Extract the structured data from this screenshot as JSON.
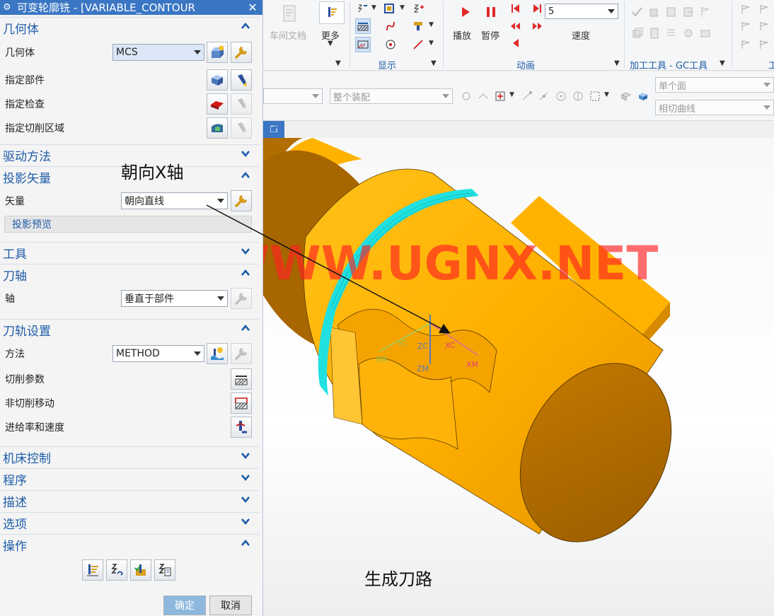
{
  "dialog": {
    "title": "可变轮廓铣 - [VARIABLE_CONTOUR",
    "geometry": {
      "header": "几何体",
      "geometry_label": "几何体",
      "geometry_value": "MCS",
      "part_label": "指定部件",
      "check_label": "指定检查",
      "cut_area_label": "指定切削区域"
    },
    "drive_method": {
      "header": "驱动方法"
    },
    "projection_vector": {
      "header": "投影矢量",
      "vector_label": "矢量",
      "vector_value": "朝向直线",
      "preview_label": "投影预览"
    },
    "tool": {
      "header": "工具"
    },
    "tool_axis": {
      "header": "刀轴",
      "axis_label": "轴",
      "axis_value": "垂直于部件"
    },
    "path_settings": {
      "header": "刀轨设置",
      "method_label": "方法",
      "method_value": "METHOD",
      "cut_params_label": "切削参数",
      "non_cutting_label": "非切削移动",
      "feeds_label": "进给率和速度"
    },
    "machine_control": {
      "header": "机床控制"
    },
    "program": {
      "header": "程序"
    },
    "description": {
      "header": "描述"
    },
    "options": {
      "header": "选项"
    },
    "actions": {
      "header": "操作"
    },
    "ok_label": "确定",
    "cancel_label": "取消"
  },
  "ribbon": {
    "shop_doc_label": "车间文档",
    "more_label": "更多",
    "display_group": "显示",
    "play_label": "播放",
    "pause_label": "暂停",
    "speed_value": "5",
    "speed_label": "速度",
    "animation_group": "动画",
    "gc_tools_group": "加工工具 - GC工具",
    "edge_group_char": "工"
  },
  "toolbar": {
    "assembly_value": "整个装配",
    "face_filter": "单个面",
    "curve_filter": "相切曲线"
  },
  "viewport": {
    "watermark": "WWW.UGNX.NET",
    "axis_labels": {
      "yc": "YC",
      "zc": "ZC",
      "xc": "XC",
      "ym": "YM",
      "zm": "ZM",
      "xm": "XM"
    }
  },
  "annotations": {
    "toward_x_axis": "朝向X轴",
    "generate_toolpath": "生成刀路"
  },
  "colors": {
    "title_bar": "#3a76c4",
    "section_header_text": "#1e5ca8",
    "part_orange": "#ffb300",
    "part_dark": "#b06d00",
    "toolpath_cyan": "#21e0e0",
    "watermark_red": "#ff2020",
    "ok_button": "#8db7dd"
  }
}
